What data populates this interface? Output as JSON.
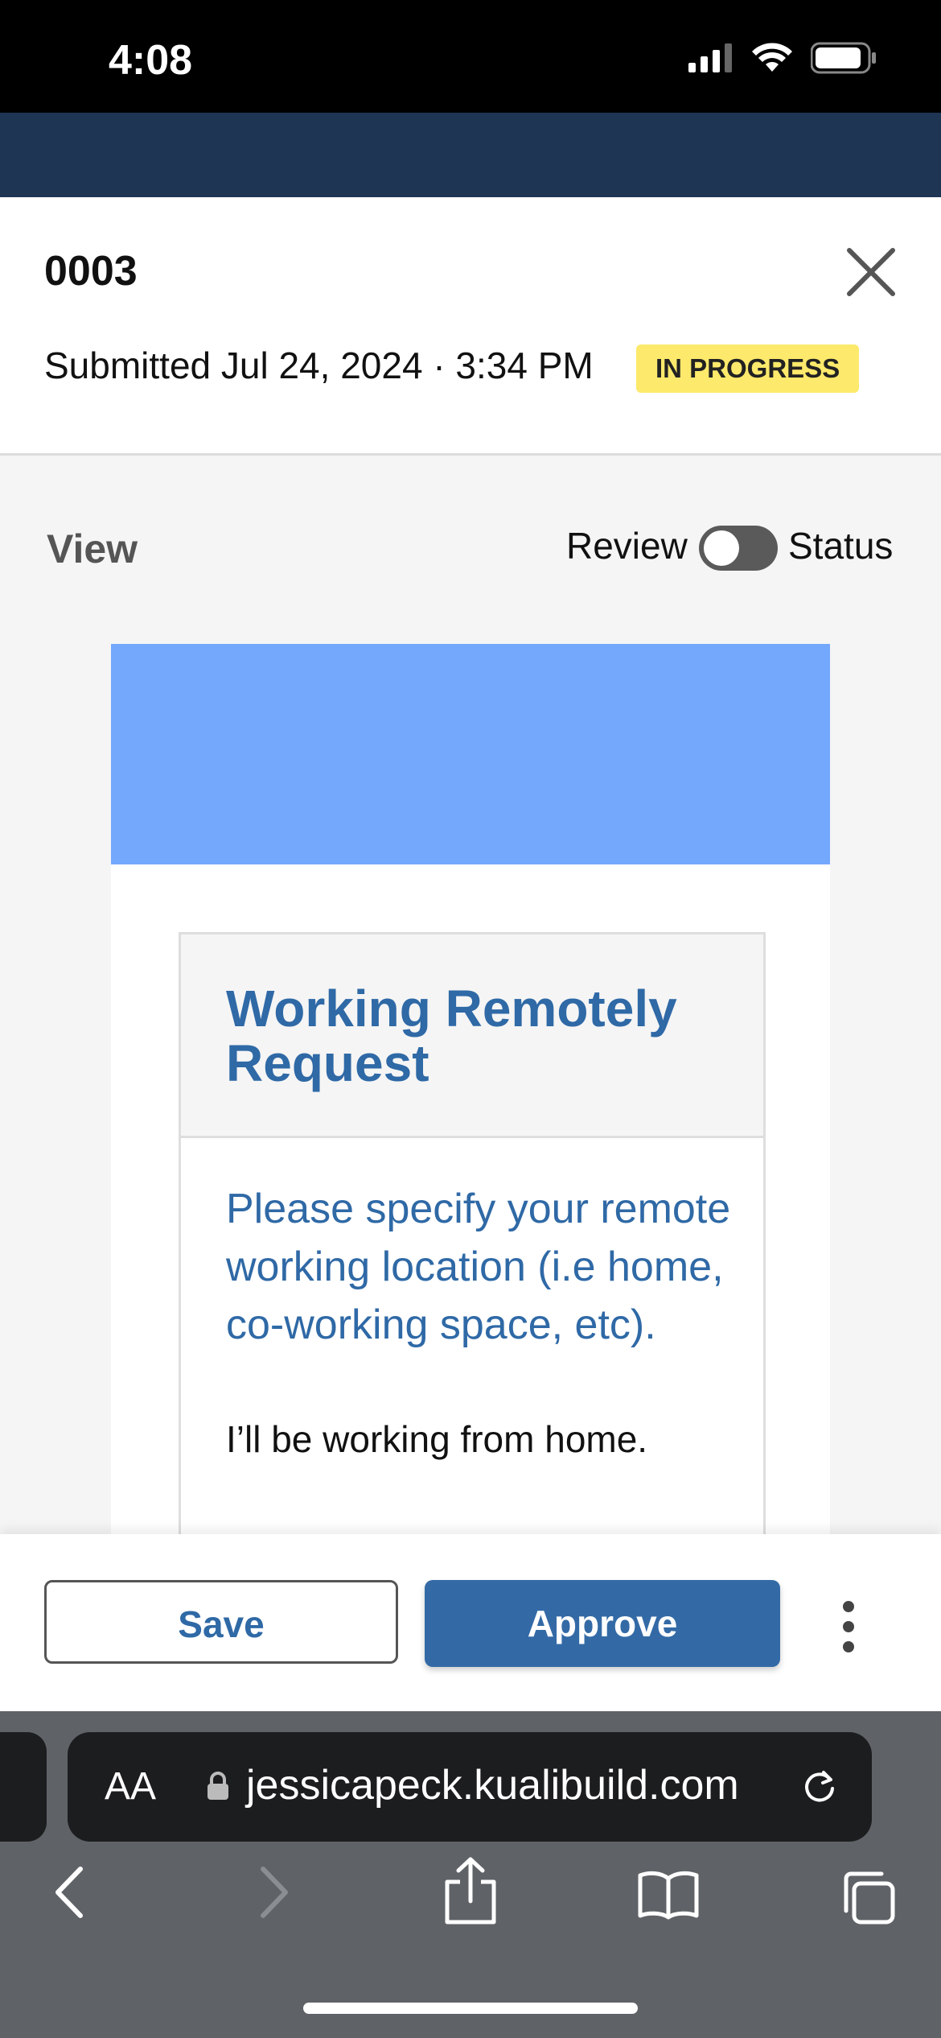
{
  "status_bar": {
    "time": "4:08"
  },
  "sheet": {
    "record_id": "0003",
    "submitted": "Submitted Jul 24, 2024 · 3:34 PM",
    "status_badge": "IN PROGRESS",
    "view_label": "View",
    "toggle": {
      "left_label": "Review",
      "right_label": "Status",
      "on": false
    }
  },
  "form": {
    "section_title": "Working Remotely Request",
    "question": "Please specify your remote working location (i.e home, co-working space, etc).",
    "answer": "I’ll be working from home."
  },
  "actions": {
    "save_label": "Save",
    "approve_label": "Approve"
  },
  "browser": {
    "text_size_label": "AA",
    "url": "jessicapeck.kualibuild.com",
    "toolbar_icons": [
      "back-icon",
      "forward-icon",
      "share-icon",
      "bookmarks-icon",
      "tabs-icon"
    ]
  },
  "colors": {
    "accent_blue": "#336aa6",
    "title_blue": "#2f69a6",
    "banner_blue": "#74a8fc",
    "badge_yellow": "#fde96b",
    "app_bar": "#1e3553"
  }
}
